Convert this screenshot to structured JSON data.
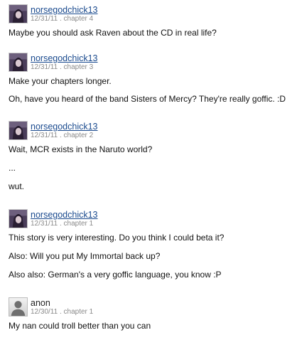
{
  "reviews": [
    {
      "author": "norsegodchick13",
      "date": "12/31/11",
      "chapter": "chapter 4",
      "paragraphs": [
        "Maybe you should ask Raven about the CD in real life?"
      ]
    },
    {
      "author": "norsegodchick13",
      "date": "12/31/11",
      "chapter": "chapter 3",
      "paragraphs": [
        "Make your chapters longer.",
        "Oh, have you heard of the band Sisters of Mercy? They're really goffic. :D"
      ]
    },
    {
      "author": "norsegodchick13",
      "date": "12/31/11",
      "chapter": "chapter 2",
      "paragraphs": [
        "Wait, MCR exists in the Naruto world?",
        "...",
        "wut."
      ]
    },
    {
      "author": "norsegodchick13",
      "date": "12/31/11",
      "chapter": "chapter 1",
      "paragraphs": [
        "This story is very interesting. Do you think I could beta it?",
        "Also: Will you put My Immortal back up?",
        "Also also: German's a very goffic language, you know :P"
      ]
    },
    {
      "author": "anon",
      "date": "12/30/11",
      "chapter": "chapter 1",
      "paragraphs": [
        "My nan could troll better than you can"
      ]
    }
  ],
  "separator": " . ",
  "icons": {
    "user_avatar": "user-avatar-icon",
    "anonymous_avatar": "anonymous-avatar-icon"
  },
  "colors": {
    "link": "#1a4a8e",
    "meta": "#8a8a8a",
    "text": "#111111"
  }
}
